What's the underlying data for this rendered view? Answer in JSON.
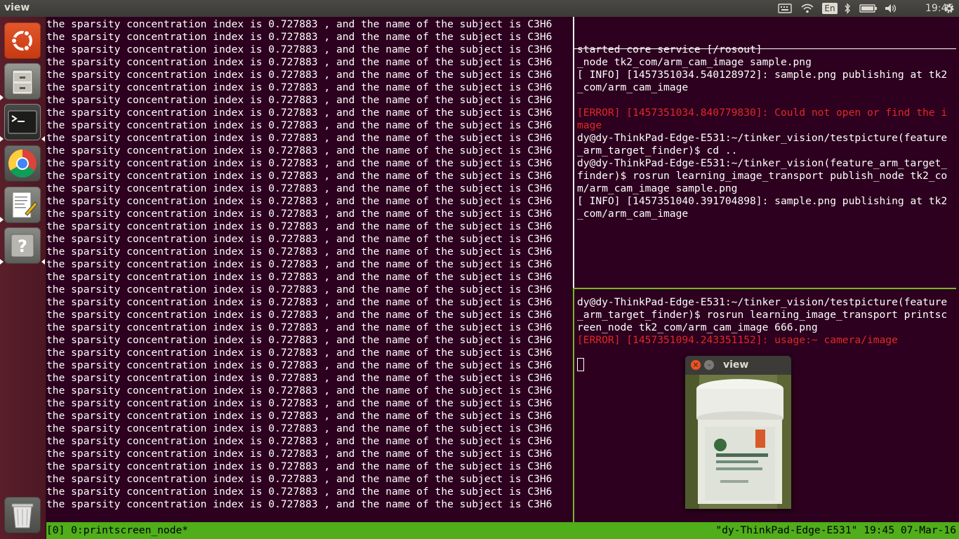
{
  "top_panel": {
    "title": "view",
    "indicators": [
      "keyboard-icon",
      "wifi-icon",
      "language-indicator",
      "bluetooth-icon",
      "battery-icon",
      "volume-icon",
      "gear-icon"
    ],
    "language": "En",
    "clock": "19:45"
  },
  "launcher": {
    "items": [
      "ubuntu-dash",
      "file-manager",
      "terminal",
      "chrome",
      "text-editor",
      "help",
      "trash"
    ]
  },
  "left_pane": {
    "line": "the sparsity concentration index is 0.727883 , and the name of the subject is C3H6",
    "line_count": 39
  },
  "top_right_pane": {
    "lines": [
      "started core service [/rosout]"
    ]
  },
  "mid_right_pane": {
    "lines": [
      {
        "text": "_node tk2_com/arm_cam_image sample.png",
        "error": false
      },
      {
        "text": "[ INFO] [1457351034.540128972]: sample.png publishing at tk2",
        "error": false
      },
      {
        "text": "_com/arm_cam_image",
        "error": false
      },
      {
        "text": "",
        "error": false
      },
      {
        "text": "[ERROR] [1457351034.840779830]: Could not open or find the i",
        "error": true
      },
      {
        "text": "mage",
        "error": true
      },
      {
        "text": "dy@dy-ThinkPad-Edge-E531:~/tinker_vision/testpicture(feature",
        "error": false
      },
      {
        "text": "_arm_target_finder)$ cd ..",
        "error": false
      },
      {
        "text": "dy@dy-ThinkPad-Edge-E531:~/tinker_vision(feature_arm_target_",
        "error": false
      },
      {
        "text": "finder)$ rosrun learning_image_transport publish_node tk2_co",
        "error": false
      },
      {
        "text": "m/arm_cam_image sample.png",
        "error": false
      },
      {
        "text": "[ INFO] [1457351040.391704898]: sample.png publishing at tk2",
        "error": false
      },
      {
        "text": "_com/arm_cam_image",
        "error": false
      }
    ]
  },
  "bot_right_pane": {
    "lines": [
      {
        "text": "dy@dy-ThinkPad-Edge-E531:~/tinker_vision/testpicture(feature",
        "error": false
      },
      {
        "text": "_arm_target_finder)$ rosrun learning_image_transport printsc",
        "error": false
      },
      {
        "text": "reen_node tk2_com/arm_cam_image 666.png",
        "error": false
      },
      {
        "text": "[ERROR] [1457351094.243351152]: usage:~ camera/image",
        "error": true
      }
    ]
  },
  "status_bar": {
    "left": "[0] 0:printscreen_node*",
    "right": "\"dy-ThinkPad-Edge-E531\" 19:45 07-Mar-16"
  },
  "view_window": {
    "title": "view",
    "close_glyph": "×",
    "min_glyph": "–"
  },
  "colors": {
    "terminal_bg": "#2c001e",
    "error": "#e22828",
    "tmux_green": "#4fae1a"
  }
}
